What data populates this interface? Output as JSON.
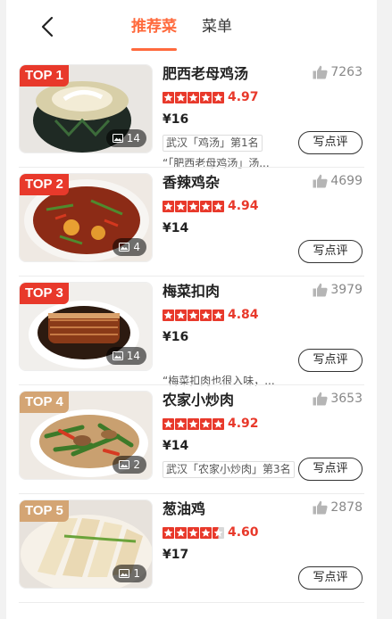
{
  "header": {
    "tabs": [
      {
        "label": "推荐菜",
        "active": true
      },
      {
        "label": "菜单",
        "active": false
      }
    ]
  },
  "colors": {
    "accent": "#ff6a3d",
    "rating_red": "#e8392b"
  },
  "dishes": [
    {
      "badge": "TOP 1",
      "badge_color": "#e8392b",
      "name": "肥西老母鸡汤",
      "likes": "7263",
      "stars": 5,
      "score": "4.97",
      "price": "¥16",
      "rank": "武汉「鸡汤」第1名",
      "quote": "“「肥西老母鸡汤」汤...",
      "photos": "14",
      "review": "写点评"
    },
    {
      "badge": "TOP 2",
      "badge_color": "#e8392b",
      "name": "香辣鸡杂",
      "likes": "4699",
      "stars": 5,
      "score": "4.94",
      "price": "¥14",
      "rank": "",
      "quote": "",
      "photos": "4",
      "review": "写点评"
    },
    {
      "badge": "TOP 3",
      "badge_color": "#e8392b",
      "name": "梅菜扣肉",
      "likes": "3979",
      "stars": 5,
      "score": "4.84",
      "price": "¥16",
      "rank": "",
      "quote": "“梅菜扣肉也很入味，...",
      "photos": "14",
      "review": "写点评"
    },
    {
      "badge": "TOP 4",
      "badge_color": "#d4a574",
      "name": "农家小炒肉",
      "likes": "3653",
      "stars": 5,
      "score": "4.92",
      "price": "¥14",
      "rank": "武汉「农家小炒肉」第3名",
      "quote": "",
      "photos": "2",
      "review": "写点评"
    },
    {
      "badge": "TOP 5",
      "badge_color": "#d4a574",
      "name": "葱油鸡",
      "likes": "2878",
      "stars": 4.5,
      "score": "4.60",
      "price": "¥17",
      "rank": "",
      "quote": "",
      "photos": "1",
      "review": "写点评"
    }
  ]
}
